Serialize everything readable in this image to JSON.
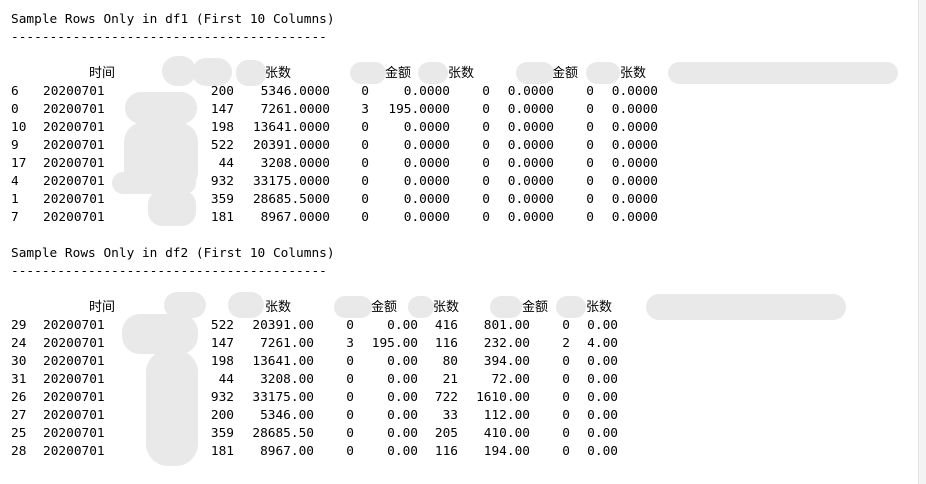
{
  "df1": {
    "title": "Sample Rows Only in df1 (First 10 Columns)",
    "separator": "-----------------------------------------",
    "headers": [
      "时间",
      "张数",
      "金额",
      "张数",
      "金额",
      "张数"
    ],
    "rows": [
      [
        "6",
        "20200701",
        "200",
        "5346.0000",
        "0",
        "0.0000",
        "0",
        "0.0000",
        "0",
        "0.0000"
      ],
      [
        "0",
        "20200701",
        "147",
        "7261.0000",
        "3",
        "195.0000",
        "0",
        "0.0000",
        "0",
        "0.0000"
      ],
      [
        "10",
        "20200701",
        "198",
        "13641.0000",
        "0",
        "0.0000",
        "0",
        "0.0000",
        "0",
        "0.0000"
      ],
      [
        "9",
        "20200701",
        "522",
        "20391.0000",
        "0",
        "0.0000",
        "0",
        "0.0000",
        "0",
        "0.0000"
      ],
      [
        "17",
        "20200701",
        "44",
        "3208.0000",
        "0",
        "0.0000",
        "0",
        "0.0000",
        "0",
        "0.0000"
      ],
      [
        "4",
        "20200701",
        "932",
        "33175.0000",
        "0",
        "0.0000",
        "0",
        "0.0000",
        "0",
        "0.0000"
      ],
      [
        "1",
        "20200701",
        "359",
        "28685.5000",
        "0",
        "0.0000",
        "0",
        "0.0000",
        "0",
        "0.0000"
      ],
      [
        "7",
        "20200701",
        "181",
        "8967.0000",
        "0",
        "0.0000",
        "0",
        "0.0000",
        "0",
        "0.0000"
      ]
    ]
  },
  "df2": {
    "title": "Sample Rows Only in df2 (First 10 Columns)",
    "separator": "-----------------------------------------",
    "headers": [
      "时间",
      "张数",
      "金额",
      "张数",
      "金额",
      "张数"
    ],
    "rows": [
      [
        "29",
        "20200701",
        "522",
        "20391.00",
        "0",
        "0.00",
        "416",
        "801.00",
        "0",
        "0.00"
      ],
      [
        "24",
        "20200701",
        "147",
        "7261.00",
        "3",
        "195.00",
        "116",
        "232.00",
        "2",
        "4.00"
      ],
      [
        "30",
        "20200701",
        "198",
        "13641.00",
        "0",
        "0.00",
        "80",
        "394.00",
        "0",
        "0.00"
      ],
      [
        "31",
        "20200701",
        "44",
        "3208.00",
        "0",
        "0.00",
        "21",
        "72.00",
        "0",
        "0.00"
      ],
      [
        "26",
        "20200701",
        "932",
        "33175.00",
        "0",
        "0.00",
        "722",
        "1610.00",
        "0",
        "0.00"
      ],
      [
        "27",
        "20200701",
        "200",
        "5346.00",
        "0",
        "0.00",
        "33",
        "112.00",
        "0",
        "0.00"
      ],
      [
        "25",
        "20200701",
        "359",
        "28685.50",
        "0",
        "0.00",
        "205",
        "410.00",
        "0",
        "0.00"
      ],
      [
        "28",
        "20200701",
        "181",
        "8967.00",
        "0",
        "0.00",
        "116",
        "194.00",
        "0",
        "0.00"
      ]
    ]
  }
}
